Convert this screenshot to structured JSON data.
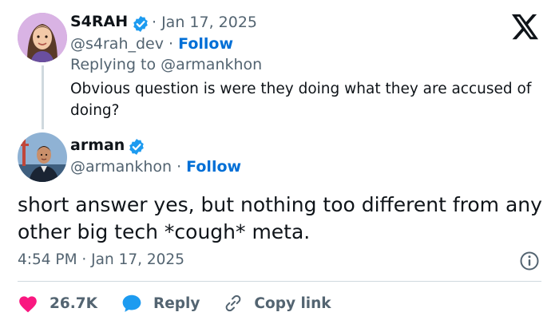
{
  "platform": {
    "logo_icon": "x-logo-icon"
  },
  "tweet1": {
    "name": "S4RAH",
    "date_sep": "· Jan 17, 2025",
    "handle": "@s4rah_dev",
    "handle_sep": "·",
    "follow_label": "Follow",
    "replying_prefix": "Replying to",
    "replying_to": "@armankhon",
    "text": "Obvious question is were they doing what they are accused of doing?",
    "verified_icon": "verified-badge-icon"
  },
  "tweet2": {
    "name": "arman",
    "handle": "@armankhon",
    "handle_sep": "·",
    "follow_label": "Follow",
    "text": "short answer yes, but nothing too different from any other big tech *cough* meta.",
    "timestamp": "4:54 PM · Jan 17, 2025",
    "verified_icon": "verified-badge-icon"
  },
  "actions": {
    "likes": "26.7K",
    "reply_label": "Reply",
    "copy_link_label": "Copy link"
  },
  "colors": {
    "accent_blue": "#006fd6",
    "like_red": "#f91880",
    "verified_blue": "#1d9bf0",
    "muted_text": "#536471"
  }
}
